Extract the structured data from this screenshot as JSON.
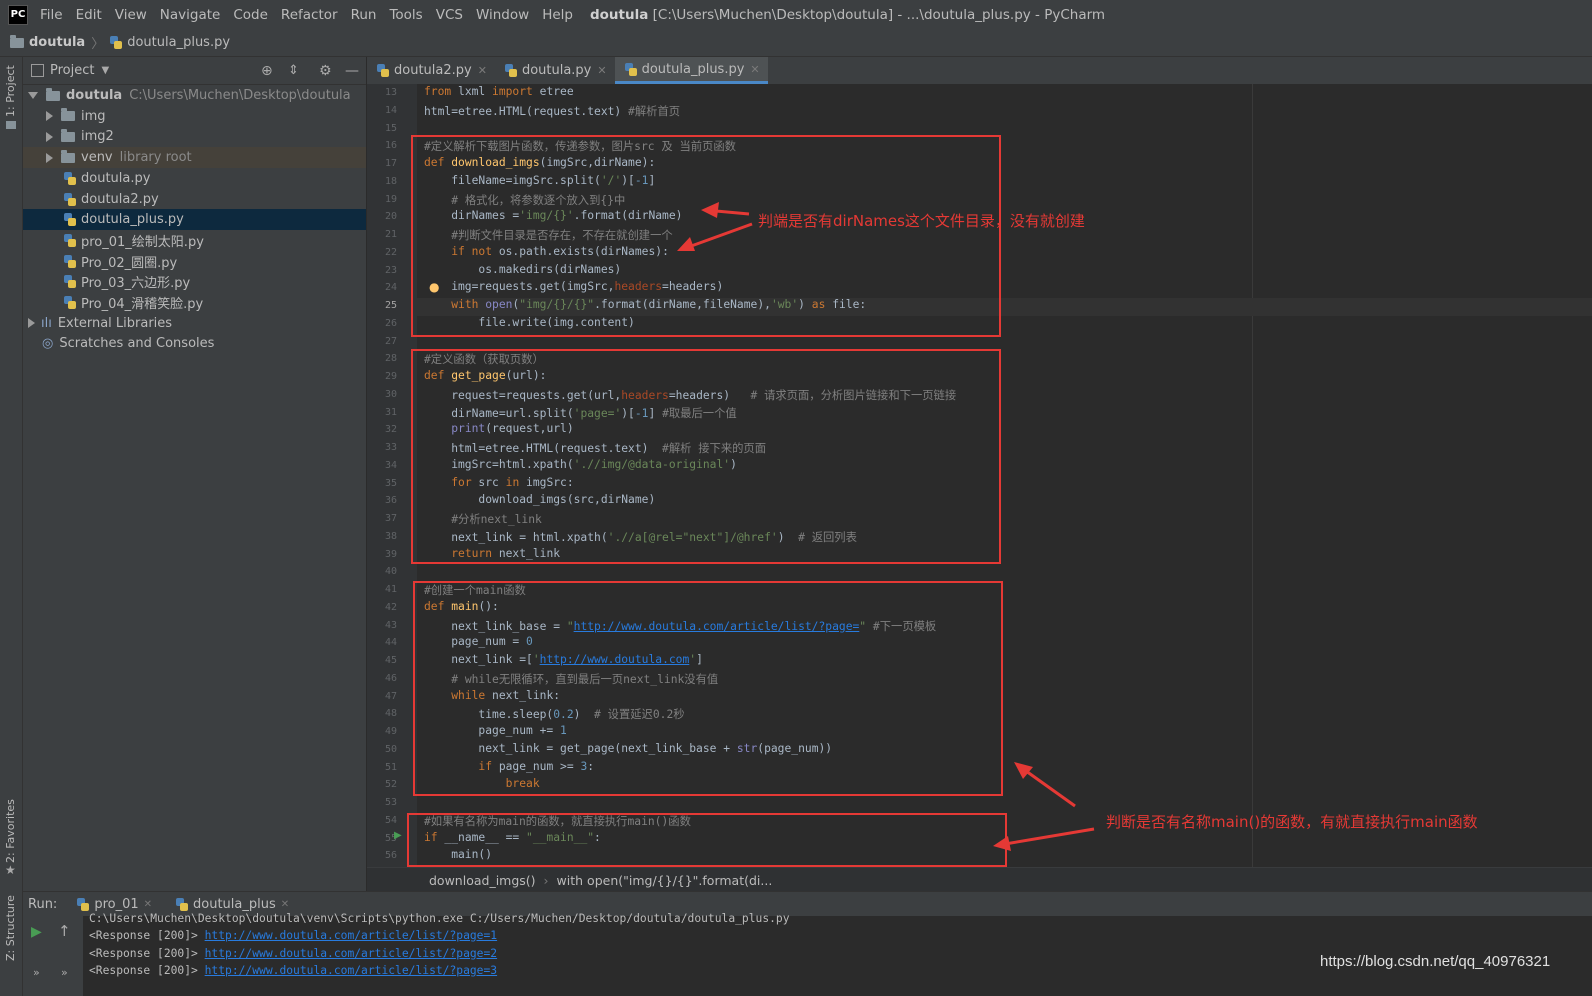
{
  "window": {
    "logo": "PC",
    "menu": [
      "File",
      "Edit",
      "View",
      "Navigate",
      "Code",
      "Refactor",
      "Run",
      "Tools",
      "VCS",
      "Window",
      "Help"
    ],
    "title_project": "doutula",
    "title_rest": "[C:\\Users\\Muchen\\Desktop\\doutula] - ...\\doutula_plus.py - PyCharm"
  },
  "breadcrumb": {
    "folder": "doutula",
    "file": "doutula_plus.py"
  },
  "left_stripe": {
    "project": "1: Project",
    "favorites": "2: Favorites",
    "structure": "Z: Structure"
  },
  "project_panel": {
    "header": "Project",
    "tree": [
      {
        "label": "doutula",
        "extra": "C:\\Users\\Muchen\\Desktop\\doutula",
        "kind": "folder",
        "expand": "open",
        "indent": 0
      },
      {
        "label": "img",
        "extra": "",
        "kind": "folder",
        "expand": "closed",
        "indent": 1
      },
      {
        "label": "img2",
        "extra": "",
        "kind": "folder",
        "expand": "closed",
        "indent": 1
      },
      {
        "label": "venv",
        "extra": "library root",
        "kind": "folder",
        "expand": "closed",
        "indent": 1,
        "state": "hl"
      },
      {
        "label": "doutula.py",
        "extra": "",
        "kind": "py",
        "expand": "",
        "indent": 2
      },
      {
        "label": "doutula2.py",
        "extra": "",
        "kind": "py",
        "expand": "",
        "indent": 2
      },
      {
        "label": "doutula_plus.py",
        "extra": "",
        "kind": "py",
        "expand": "",
        "indent": 2,
        "state": "sel"
      },
      {
        "label": "pro_01_绘制太阳.py",
        "extra": "",
        "kind": "py",
        "expand": "",
        "indent": 2
      },
      {
        "label": "Pro_02_圆圈.py",
        "extra": "",
        "kind": "py",
        "expand": "",
        "indent": 2
      },
      {
        "label": "Pro_03_六边形.py",
        "extra": "",
        "kind": "py",
        "expand": "",
        "indent": 2
      },
      {
        "label": "Pro_04_滑稽笑脸.py",
        "extra": "",
        "kind": "py",
        "expand": "",
        "indent": 2
      },
      {
        "label": "External Libraries",
        "extra": "",
        "kind": "lib",
        "expand": "closed",
        "indent": 0
      },
      {
        "label": "Scratches and Consoles",
        "extra": "",
        "kind": "scratch",
        "expand": "",
        "indent": 0
      }
    ]
  },
  "tabs": [
    {
      "label": "doutula2.py",
      "active": false
    },
    {
      "label": "doutula.py",
      "active": false
    },
    {
      "label": "doutula_plus.py",
      "active": true
    }
  ],
  "code": {
    "current_line": 25,
    "lines": [
      {
        "n": 13,
        "html": "<span class='k'>from</span> lxml <span class='k'>import</span> etree"
      },
      {
        "n": 14,
        "html": "html=etree.HTML(request.text) <span class='c'>#解析首页</span>"
      },
      {
        "n": 15,
        "html": ""
      },
      {
        "n": 16,
        "html": "<span class='c'>#定义解析下载图片函数，传递参数，图片src 及 当前页函数</span>"
      },
      {
        "n": 17,
        "html": "<span class='k'>def</span> <span class='f'>download_imgs</span>(imgSrc,dirName):"
      },
      {
        "n": 18,
        "html": "    fileName=imgSrc.split(<span class='s'>'/'</span>)[<span class='n'>-1</span>]"
      },
      {
        "n": 19,
        "html": "    <span class='c'># 格式化，将参数逐个放入到{}中</span>"
      },
      {
        "n": 20,
        "html": "    dirNames =<span class='s'>'img/{}'</span>.format(dirName)"
      },
      {
        "n": 21,
        "html": "    <span class='c'>#判断文件目录是否存在，不存在就创建一个</span>"
      },
      {
        "n": 22,
        "html": "    <span class='k'>if not</span> os.path.exists(dirNames):"
      },
      {
        "n": 23,
        "html": "        os.makedirs(dirNames)"
      },
      {
        "n": 24,
        "html": "    img=requests.get(imgSrc,<span class='p'>headers</span>=headers)"
      },
      {
        "n": 25,
        "html": "    <span class='k'>with</span> <span class='b'>open</span>(<span class='s'>\"img/{}/{}\"</span>.format(dirName,fileName),<span class='s'>'wb'</span>) <span class='k'>as</span> file:"
      },
      {
        "n": 26,
        "html": "        file.write(img.content)"
      },
      {
        "n": 27,
        "html": ""
      },
      {
        "n": 28,
        "html": "<span class='c'>#定义函数（获取页数）</span>"
      },
      {
        "n": 29,
        "html": "<span class='k'>def</span> <span class='f'>get_page</span>(url):"
      },
      {
        "n": 30,
        "html": "    request=requests.get(url,<span class='p'>headers</span>=headers)   <span class='c'># 请求页面，分析图片链接和下一页链接</span>"
      },
      {
        "n": 31,
        "html": "    dirName=url.split(<span class='s'>'page='</span>)[<span class='n'>-1</span>] <span class='c'>#取最后一个值</span>"
      },
      {
        "n": 32,
        "html": "    <span class='b'>print</span>(request,url)"
      },
      {
        "n": 33,
        "html": "    html=etree.HTML(request.text)  <span class='c'>#解析 接下来的页面</span>"
      },
      {
        "n": 34,
        "html": "    imgSrc=html.xpath(<span class='s'>'.//img/@data-original'</span>)"
      },
      {
        "n": 35,
        "html": "    <span class='k'>for</span> src <span class='k'>in</span> imgSrc:"
      },
      {
        "n": 36,
        "html": "        download_imgs(src,dirName)"
      },
      {
        "n": 37,
        "html": "    <span class='c'>#分析next_link</span>"
      },
      {
        "n": 38,
        "html": "    next_link = html.xpath(<span class='s'>'.//a[@rel=\"next\"]/@href'</span>)  <span class='c'># 返回列表</span>"
      },
      {
        "n": 39,
        "html": "    <span class='k'>return</span> next_link"
      },
      {
        "n": 40,
        "html": ""
      },
      {
        "n": 41,
        "html": "<span class='c'>#创建一个main函数</span>"
      },
      {
        "n": 42,
        "html": "<span class='k'>def</span> <span class='f'>main</span>():"
      },
      {
        "n": 43,
        "html": "    next_link_base = <span class='s'>\"<span class='u'>http://www.doutula.com/article/list/?page=</span>\"</span> <span class='c'>#下一页模板</span>"
      },
      {
        "n": 44,
        "html": "    page_num = <span class='n'>0</span>"
      },
      {
        "n": 45,
        "html": "    next_link =[<span class='s'>'<span class='u'>http://www.doutula.com</span>'</span>]"
      },
      {
        "n": 46,
        "html": "    <span class='c'># while无限循环，直到最后一页next_link没有值</span>"
      },
      {
        "n": 47,
        "html": "    <span class='k'>while</span> next_link:"
      },
      {
        "n": 48,
        "html": "        time.sleep(<span class='n'>0.2</span>)  <span class='c'># 设置延迟0.2秒</span>"
      },
      {
        "n": 49,
        "html": "        page_num += <span class='n'>1</span>"
      },
      {
        "n": 50,
        "html": "        next_link = get_page(next_link_base + <span class='b'>str</span>(page_num))"
      },
      {
        "n": 51,
        "html": "        <span class='k'>if</span> page_num >= <span class='n'>3</span>:"
      },
      {
        "n": 52,
        "html": "            <span class='k'>break</span>"
      },
      {
        "n": 53,
        "html": ""
      },
      {
        "n": 54,
        "html": "<span class='c'>#如果有名称为main的函数，就直接执行main()函数</span>"
      },
      {
        "n": 55,
        "html": "<span class='k'>if</span> __name__ == <span class='s'>\"__main__\"</span>:"
      },
      {
        "n": 56,
        "html": "    main()"
      }
    ]
  },
  "annotations": {
    "top": "判端是否有dirNames这个文件目录，没有就创建",
    "bottom": "判断是否有名称main()的函数，有就直接执行main函数"
  },
  "editor_breadcrumb": {
    "fn": "download_imgs()",
    "stmt": "with open(\"img/{}/{}\".format(di..."
  },
  "run": {
    "label": "Run:",
    "tabs": [
      "pro_01",
      "doutula_plus"
    ],
    "cmd": "C:\\Users\\Muchen\\Desktop\\doutula\\venv\\Scripts\\python.exe C:/Users/Muchen/Desktop/doutula/doutula_plus.py",
    "output": [
      {
        "prefix": "<Response [200]> ",
        "link": "http://www.doutula.com/article/list/?page=1"
      },
      {
        "prefix": "<Response [200]> ",
        "link": "http://www.doutula.com/article/list/?page=2"
      },
      {
        "prefix": "<Response [200]> ",
        "link": "http://www.doutula.com/article/list/?page=3"
      }
    ]
  },
  "watermark": "https://blog.csdn.net/qq_40976321",
  "colors": {
    "accent": "#4a88c7",
    "annotation_red": "#e53935",
    "keyword": "#cc7832",
    "string": "#6a8759"
  }
}
